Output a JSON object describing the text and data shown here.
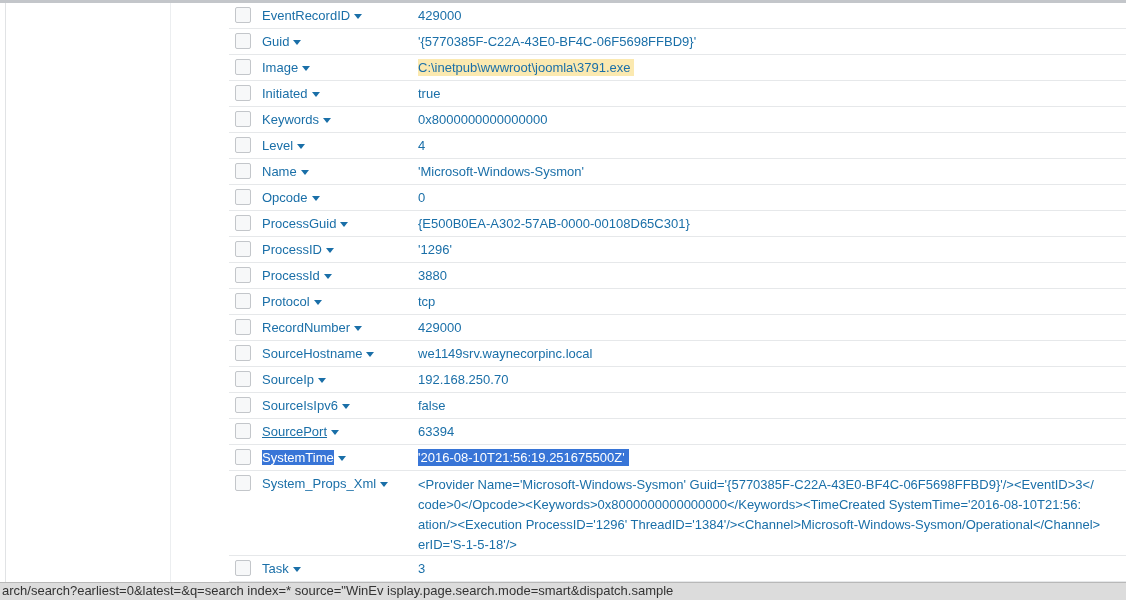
{
  "rows": [
    {
      "field": "EventRecordID",
      "value": "429000",
      "checked": false,
      "highlighted": false,
      "underlined": false,
      "selected": false
    },
    {
      "field": "Guid",
      "value": "'{5770385F-C22A-43E0-BF4C-06F5698FFBD9}'",
      "checked": false,
      "highlighted": false,
      "underlined": false,
      "selected": false
    },
    {
      "field": "Image",
      "value": "C:\\inetpub\\wwwroot\\joomla\\3791.exe",
      "checked": false,
      "highlighted": true,
      "underlined": false,
      "selected": false
    },
    {
      "field": "Initiated",
      "value": "true",
      "checked": false,
      "highlighted": false,
      "underlined": false,
      "selected": false
    },
    {
      "field": "Keywords",
      "value": "0x8000000000000000",
      "checked": false,
      "highlighted": false,
      "underlined": false,
      "selected": false
    },
    {
      "field": "Level",
      "value": "4",
      "checked": false,
      "highlighted": false,
      "underlined": false,
      "selected": false
    },
    {
      "field": "Name",
      "value": "'Microsoft-Windows-Sysmon'",
      "checked": false,
      "highlighted": false,
      "underlined": false,
      "selected": false
    },
    {
      "field": "Opcode",
      "value": "0",
      "checked": false,
      "highlighted": false,
      "underlined": false,
      "selected": false
    },
    {
      "field": "ProcessGuid",
      "value": "{E500B0EA-A302-57AB-0000-00108D65C301}",
      "checked": false,
      "highlighted": false,
      "underlined": false,
      "selected": false
    },
    {
      "field": "ProcessID",
      "value": "'1296'",
      "checked": false,
      "highlighted": false,
      "underlined": false,
      "selected": false
    },
    {
      "field": "ProcessId",
      "value": "3880",
      "checked": false,
      "highlighted": false,
      "underlined": false,
      "selected": false
    },
    {
      "field": "Protocol",
      "value": "tcp",
      "checked": false,
      "highlighted": false,
      "underlined": false,
      "selected": false
    },
    {
      "field": "RecordNumber",
      "value": "429000",
      "checked": false,
      "highlighted": false,
      "underlined": false,
      "selected": false
    },
    {
      "field": "SourceHostname",
      "value": "we1149srv.waynecorpinc.local",
      "checked": false,
      "highlighted": false,
      "underlined": false,
      "selected": false
    },
    {
      "field": "SourceIp",
      "value": "192.168.250.70",
      "checked": false,
      "highlighted": false,
      "underlined": false,
      "selected": false
    },
    {
      "field": "SourceIsIpv6",
      "value": "false",
      "checked": false,
      "highlighted": false,
      "underlined": false,
      "selected": false
    },
    {
      "field": "SourcePort",
      "value": "63394",
      "checked": false,
      "highlighted": false,
      "underlined": true,
      "selected": false
    },
    {
      "field": "SystemTime",
      "value": "'2016-08-10T21:56:19.251675500Z'",
      "checked": false,
      "highlighted": false,
      "underlined": false,
      "selected": true
    },
    {
      "field": "System_Props_Xml",
      "value_lines": [
        "<Provider Name='Microsoft-Windows-Sysmon' Guid='{5770385F-C22A-43E0-BF4C-06F5698FFBD9}'/><EventID>3</",
        "code>0</Opcode><Keywords>0x8000000000000000</Keywords><TimeCreated SystemTime='2016-08-10T21:56:",
        "ation/><Execution ProcessID='1296' ThreadID='1384'/><Channel>Microsoft-Windows-Sysmon/Operational</Channel>",
        "erID='S-1-5-18'/>"
      ],
      "checked": false,
      "highlighted": false,
      "underlined": false,
      "selected": false
    },
    {
      "field": "Task",
      "value": "3",
      "checked": false,
      "highlighted": false,
      "underlined": false,
      "selected": false
    }
  ],
  "status_bar": {
    "url": "arch/search?earliest=0&latest=&q=search index=* source=\"WinEv   isplay.page.search.mode=smart&dispatch.sample"
  }
}
